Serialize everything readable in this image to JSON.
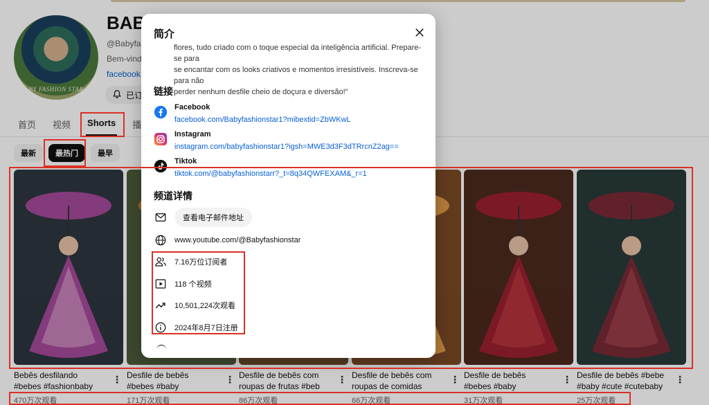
{
  "channel": {
    "name": "BABY FASHION STAR",
    "name_visible": "BAB",
    "avatar_text": "BY FASHION STAR",
    "handle": "@Babyfash",
    "desc_snippet": "Bem-vindo",
    "link_snippet": "facebook.c",
    "subscribe_label": "已订"
  },
  "tabs": [
    {
      "label": "首页",
      "active": false
    },
    {
      "label": "视频",
      "active": false
    },
    {
      "label": "Shorts",
      "active": true
    },
    {
      "label": "播放",
      "active": false
    }
  ],
  "chips": [
    {
      "label": "最新",
      "active": false
    },
    {
      "label": "最热门",
      "active": true
    },
    {
      "label": "最早",
      "active": false
    }
  ],
  "videos": [
    {
      "title_line1": "Bebês desfilando",
      "title_line2": "#bebes #fashionbaby",
      "views": "470万次观看",
      "palette": [
        "#2d3640",
        "#a64a9a",
        "#e1b0d6"
      ]
    },
    {
      "title_line1": "Desfile de bebês",
      "title_line2": "#bebes #baby",
      "views": "171万次观看",
      "palette": [
        "#4e5b3a",
        "#c67c2d",
        "#ead39a"
      ]
    },
    {
      "title_line1": "Desfile de bebês com",
      "title_line2": "roupas de frutas #beb",
      "views": "86万次观看",
      "palette": [
        "#6a4a2a",
        "#d98a3c",
        "#f0d6a0"
      ]
    },
    {
      "title_line1": "Desfile de bebês com",
      "title_line2": "roupas de comidas",
      "views": "66万次观看",
      "palette": [
        "#7a4a26",
        "#e09a48",
        "#f3dcae"
      ]
    },
    {
      "title_line1": "Desfile de bebês",
      "title_line2": "#bebes #baby",
      "views": "31万次观看",
      "palette": [
        "#4c2a20",
        "#9c2030",
        "#c84646"
      ]
    },
    {
      "title_line1": "Desfile de bebês #bebe",
      "title_line2": "#baby #cute #cutebaby",
      "views": "25万次观看",
      "palette": [
        "#2a3a3a",
        "#7a2a36",
        "#b24a58"
      ]
    }
  ],
  "modal": {
    "title": "简介",
    "description_lines": [
      "flores, tudo criado com o toque especial da inteligência artificial. Prepare-se para",
      "se encantar com os looks criativos e momentos irresistíveis. Inscreva-se para não",
      "perder nenhum desfile cheio de doçura e diversão!\""
    ],
    "links_heading": "链接",
    "links": [
      {
        "name": "Facebook",
        "url": "facebook.com/Babyfashionstar1?mibextid=ZbWKwL",
        "icon": "facebook-icon"
      },
      {
        "name": "Instagram",
        "url": "instagram.com/babyfashionstar1?igsh=MWE3d3F3dTRrcnZ2ag==",
        "icon": "instagram-icon"
      },
      {
        "name": "Tiktok",
        "url": "tiktok.com/@babyfashionstarr?_t=8q34QWFEXAM&_r=1",
        "icon": "tiktok-icon"
      }
    ],
    "details_heading": "频道详情",
    "email_button": "查看电子邮件地址",
    "channel_url": "www.youtube.com/@Babyfashionstar",
    "subscribers": "7.16万位订阅者",
    "video_count": "118 个视频",
    "total_views": "10,501,224次观看",
    "joined": "2024年8月7日注册"
  },
  "colors": {
    "highlight": "#d93025",
    "link": "#065fd4",
    "facebook": "#1877f2"
  }
}
